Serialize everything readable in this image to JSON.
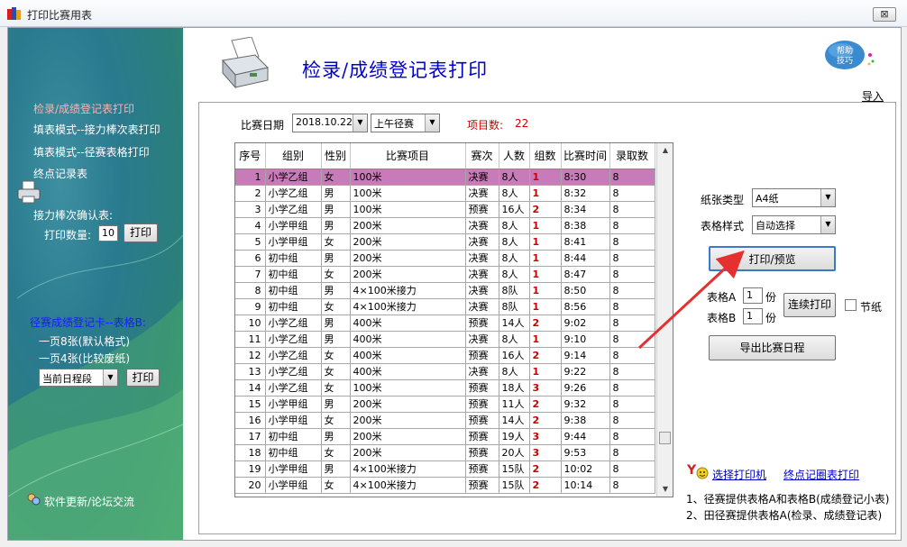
{
  "window": {
    "title": "打印比赛用表",
    "close_glyph": "⊠"
  },
  "sidebar": {
    "links": [
      {
        "label": "检录/成绩登记表打印",
        "active": true
      },
      {
        "label": "填表模式--接力棒次表打印",
        "active": false
      },
      {
        "label": "填表模式--径赛表格打印",
        "active": false
      },
      {
        "label": "终点记录表",
        "active": false
      }
    ],
    "relay_confirm_label": "接力棒次确认表:",
    "print_qty_label": "打印数量:",
    "print_qty_value": "10",
    "print_button": "打印",
    "track_card_heading": "径赛成绩登记卡--表格B:",
    "page8_option": "一页8张(默认格式)",
    "page4_option": "一页4张(比较废纸)",
    "schedule_select": "当前日程段",
    "print_button2": "打印",
    "update_forum": "软件更新/论坛交流"
  },
  "header": {
    "title": "检录/成绩登记表打印",
    "help_badge": "帮助\n技巧",
    "help_line1": "帮助",
    "help_line2": "技巧",
    "import_link": "导入"
  },
  "filters": {
    "date_label": "比赛日期",
    "date_value": "2018.10.22",
    "session_value": "上午径赛",
    "item_count_label": "项目数:",
    "item_count": "22"
  },
  "table": {
    "columns": [
      "序号",
      "组别",
      "性别",
      "比赛项目",
      "赛次",
      "人数",
      "组数",
      "比赛时间",
      "录取数"
    ],
    "rows": [
      [
        "1",
        "小学乙组",
        "女",
        "100米",
        "决赛",
        "8人",
        "1",
        "8:30",
        "8"
      ],
      [
        "2",
        "小学乙组",
        "男",
        "100米",
        "决赛",
        "8人",
        "1",
        "8:32",
        "8"
      ],
      [
        "3",
        "小学乙组",
        "男",
        "100米",
        "预赛",
        "16人",
        "2",
        "8:34",
        "8"
      ],
      [
        "4",
        "小学甲组",
        "男",
        "200米",
        "决赛",
        "8人",
        "1",
        "8:38",
        "8"
      ],
      [
        "5",
        "小学甲组",
        "女",
        "200米",
        "决赛",
        "8人",
        "1",
        "8:41",
        "8"
      ],
      [
        "6",
        "初中组",
        "男",
        "200米",
        "决赛",
        "8人",
        "1",
        "8:44",
        "8"
      ],
      [
        "7",
        "初中组",
        "女",
        "200米",
        "决赛",
        "8人",
        "1",
        "8:47",
        "8"
      ],
      [
        "8",
        "初中组",
        "男",
        "4×100米接力",
        "决赛",
        "8队",
        "1",
        "8:50",
        "8"
      ],
      [
        "9",
        "初中组",
        "女",
        "4×100米接力",
        "决赛",
        "8队",
        "1",
        "8:56",
        "8"
      ],
      [
        "10",
        "小学乙组",
        "男",
        "400米",
        "预赛",
        "14人",
        "2",
        "9:02",
        "8"
      ],
      [
        "11",
        "小学乙组",
        "男",
        "400米",
        "决赛",
        "8人",
        "1",
        "9:10",
        "8"
      ],
      [
        "12",
        "小学乙组",
        "女",
        "400米",
        "预赛",
        "16人",
        "2",
        "9:14",
        "8"
      ],
      [
        "13",
        "小学乙组",
        "女",
        "400米",
        "决赛",
        "8人",
        "1",
        "9:22",
        "8"
      ],
      [
        "14",
        "小学乙组",
        "女",
        "100米",
        "预赛",
        "18人",
        "3",
        "9:26",
        "8"
      ],
      [
        "15",
        "小学甲组",
        "男",
        "200米",
        "预赛",
        "11人",
        "2",
        "9:32",
        "8"
      ],
      [
        "16",
        "小学甲组",
        "女",
        "200米",
        "预赛",
        "14人",
        "2",
        "9:38",
        "8"
      ],
      [
        "17",
        "初中组",
        "男",
        "200米",
        "预赛",
        "19人",
        "3",
        "9:44",
        "8"
      ],
      [
        "18",
        "初中组",
        "女",
        "200米",
        "预赛",
        "20人",
        "3",
        "9:53",
        "8"
      ],
      [
        "19",
        "小学甲组",
        "男",
        "4×100米接力",
        "预赛",
        "15队",
        "2",
        "10:02",
        "8"
      ],
      [
        "20",
        "小学甲组",
        "女",
        "4×100米接力",
        "预赛",
        "15队",
        "2",
        "10:14",
        "8"
      ]
    ],
    "selected_row": 0
  },
  "right_panel": {
    "paper_type_label": "纸张类型",
    "paper_type_value": "A4纸",
    "table_style_label": "表格样式",
    "table_style_value": "自动选择",
    "print_preview_button": "打印/预览",
    "table_a_label": "表格A",
    "table_a_value": "1",
    "table_b_label": "表格B",
    "table_b_value": "1",
    "copies_unit": "份",
    "continuous_print_button": "连续打印",
    "saving_label": "节纸",
    "export_schedule_button": "导出比赛日程",
    "select_printer_link": "选择打印机",
    "finish_lap_link": "终点记圈表打印",
    "notes": [
      "1、径赛提供表格A和表格B(成绩登记小表)",
      "2、田径赛提供表格A(检录、成绩登记表)"
    ]
  },
  "colors": {
    "selected_row": "#c77bb8",
    "title_blue": "#0000cc",
    "group_red": "#cc0000",
    "arrow_red": "#e53030"
  }
}
